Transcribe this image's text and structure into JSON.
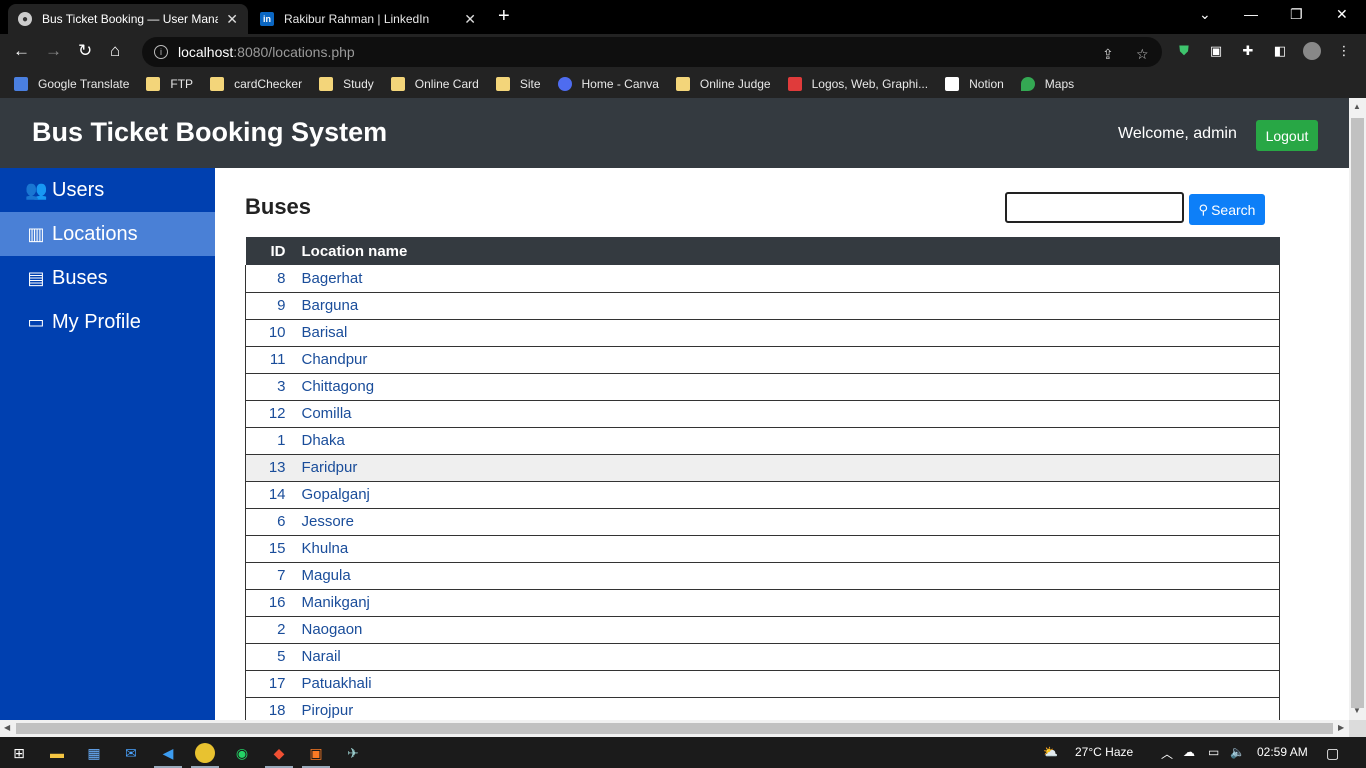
{
  "browser": {
    "tabs": [
      {
        "title": "Bus Ticket Booking — User Mana",
        "active": true
      },
      {
        "title": "Rakibur Rahman | LinkedIn",
        "active": false
      }
    ],
    "url_host": "localhost",
    "url_rest": ":8080/locations.php",
    "bookmarks": [
      {
        "label": "Google Translate"
      },
      {
        "label": "FTP"
      },
      {
        "label": "cardChecker"
      },
      {
        "label": "Study"
      },
      {
        "label": "Online Card"
      },
      {
        "label": "Site"
      },
      {
        "label": "Home - Canva"
      },
      {
        "label": "Online Judge"
      },
      {
        "label": "Logos, Web, Graphi..."
      },
      {
        "label": "Notion"
      },
      {
        "label": "Maps"
      }
    ]
  },
  "header": {
    "brand": "Bus Ticket Booking System",
    "welcome": "Welcome, admin",
    "logout_label": "Logout"
  },
  "sidebar": {
    "items": [
      {
        "label": "Users",
        "icon": "users-icon"
      },
      {
        "label": "Locations",
        "icon": "map-icon",
        "active": true
      },
      {
        "label": "Buses",
        "icon": "bus-icon"
      },
      {
        "label": "My Profile",
        "icon": "id-card-icon"
      }
    ]
  },
  "main": {
    "heading": "Buses",
    "search": {
      "value": "",
      "button_label": "Search"
    },
    "table": {
      "columns": [
        "ID",
        "Location name"
      ],
      "rows": [
        {
          "id": "8",
          "name": "Bagerhat"
        },
        {
          "id": "9",
          "name": "Barguna"
        },
        {
          "id": "10",
          "name": "Barisal"
        },
        {
          "id": "11",
          "name": "Chandpur"
        },
        {
          "id": "3",
          "name": "Chittagong"
        },
        {
          "id": "12",
          "name": "Comilla"
        },
        {
          "id": "1",
          "name": "Dhaka"
        },
        {
          "id": "13",
          "name": "Faridpur"
        },
        {
          "id": "14",
          "name": "Gopalganj"
        },
        {
          "id": "6",
          "name": "Jessore"
        },
        {
          "id": "15",
          "name": "Khulna"
        },
        {
          "id": "7",
          "name": "Magula"
        },
        {
          "id": "16",
          "name": "Manikganj"
        },
        {
          "id": "2",
          "name": "Naogaon"
        },
        {
          "id": "5",
          "name": "Narail"
        },
        {
          "id": "17",
          "name": "Patuakhali"
        },
        {
          "id": "18",
          "name": "Pirojpur"
        }
      ]
    }
  },
  "taskbar": {
    "weather": "27°C  Haze",
    "time": "02:59 AM"
  },
  "colors": {
    "header_bg": "#343a40",
    "sidebar_bg": "#0040b0",
    "sidebar_active": "#4a80d6",
    "logout_bg": "#28a745",
    "search_btn_bg": "#0d7ff8",
    "link_color": "#1a4d9a"
  }
}
